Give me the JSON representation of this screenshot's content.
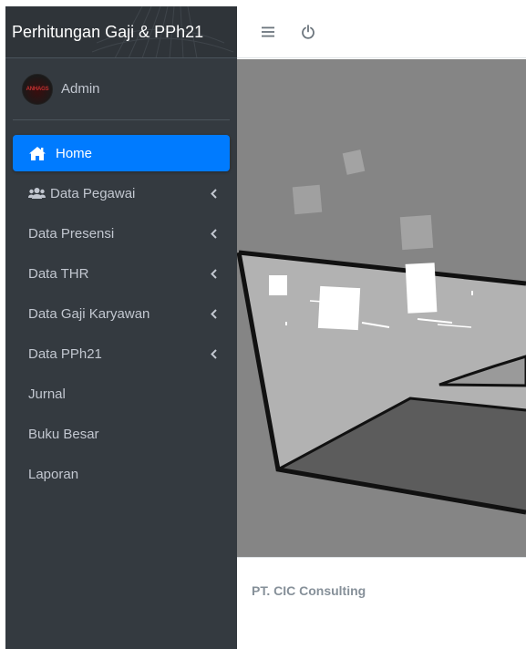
{
  "brand": {
    "title": "Perhitungan Gaji & PPh21"
  },
  "user": {
    "name": "Admin",
    "avatar_text": "ANHAGS"
  },
  "nav": {
    "items": [
      {
        "label": "Home",
        "icon": "home-icon",
        "active": true,
        "has_children": false
      },
      {
        "label": "Data Pegawai",
        "icon": "users-icon",
        "active": false,
        "has_children": true
      },
      {
        "label": "Data Presensi",
        "icon": "",
        "active": false,
        "has_children": true
      },
      {
        "label": "Data THR",
        "icon": "",
        "active": false,
        "has_children": true
      },
      {
        "label": "Data Gaji Karyawan",
        "icon": "",
        "active": false,
        "has_children": true
      },
      {
        "label": "Data PPh21",
        "icon": "",
        "active": false,
        "has_children": true
      },
      {
        "label": "Jurnal",
        "icon": "",
        "active": false,
        "has_children": false
      },
      {
        "label": "Buku Besar",
        "icon": "",
        "active": false,
        "has_children": false
      },
      {
        "label": "Laporan",
        "icon": "",
        "active": false,
        "has_children": false
      }
    ]
  },
  "topbar": {
    "menu_icon": "hamburger-icon",
    "power_icon": "power-icon"
  },
  "footer": {
    "company": "PT. CIC Consulting"
  },
  "colors": {
    "sidebar_bg": "#343a40",
    "active": "#007bff",
    "text": "#c2c7d0",
    "footer_text": "#869099"
  }
}
